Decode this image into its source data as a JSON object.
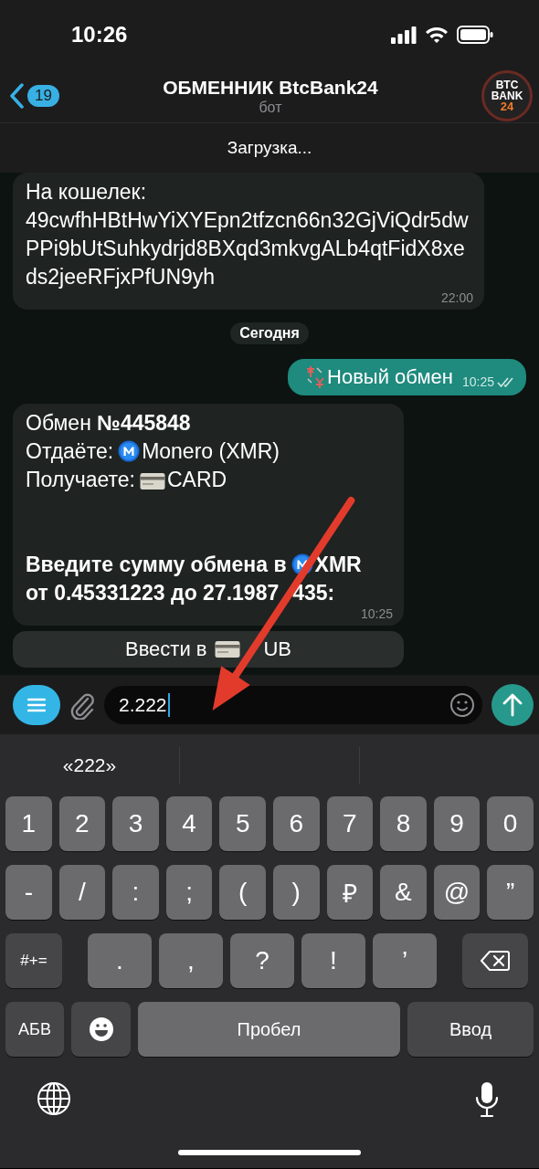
{
  "status_bar": {
    "time": "10:26"
  },
  "header": {
    "back_badge": "19",
    "title": "ОБМЕННИК BtcBank24",
    "subtitle": "бот",
    "avatar": [
      "BTC",
      "BANK",
      "24"
    ]
  },
  "banner": {
    "text": "Загрузка..."
  },
  "messages": [
    {
      "kind": "incoming",
      "time": "22:00",
      "lines": [
        {
          "bold": false,
          "parts": [
            {
              "kind": "text",
              "text": "На кошелек:"
            }
          ]
        },
        {
          "bold": false,
          "parts": [
            {
              "kind": "text",
              "text": "49cwfhHBtHwYiXYEpn2tfzcn66n32GjViQdr5dwPPi9bUtSuhkydrjd8BXqd3mkvgALb4qtFidX8xeds2jeeRFjxPfUN9yh"
            }
          ]
        }
      ]
    },
    {
      "kind": "date",
      "text": "Сегодня"
    },
    {
      "kind": "outgoing",
      "time": "10:25",
      "read": true,
      "lines": [
        {
          "bold": false,
          "parts": [
            {
              "kind": "exchange-emoji"
            },
            {
              "kind": "text",
              "text": "Новый обмен"
            }
          ]
        }
      ]
    },
    {
      "kind": "incoming",
      "time": "10:25",
      "lines": [
        {
          "bold": false,
          "parts": [
            {
              "kind": "text",
              "text": "Обмен **№445848**"
            }
          ]
        },
        {
          "bold": false,
          "parts": [
            {
              "kind": "text",
              "text": "Отдаёте:"
            },
            {
              "kind": "coin-emoji"
            },
            {
              "kind": "text",
              "text": "Monero (XMR)"
            }
          ]
        },
        {
          "bold": false,
          "parts": [
            {
              "kind": "text",
              "text": "Получаете:"
            },
            {
              "kind": "card-emoji"
            },
            {
              "kind": "text",
              "text": "CARD"
            }
          ]
        },
        {
          "bold": true,
          "parts": [
            {
              "kind": "text",
              "text": "Введите сумму обмена в"
            },
            {
              "kind": "coin-emoji"
            },
            {
              "kind": "text",
              "text": "XMR"
            }
          ]
        },
        {
          "bold": true,
          "parts": [
            {
              "kind": "text",
              "text": "от 0.45331223 до 27.1987"
            },
            {
              "kind": "covered"
            },
            {
              "kind": "text",
              "text": "435:"
            }
          ]
        }
      ]
    },
    {
      "kind": "inline_button",
      "parts": [
        {
          "kind": "text",
          "text": "Ввести в"
        },
        {
          "kind": "card-emoji"
        },
        {
          "kind": "covered"
        },
        {
          "kind": "text",
          "text": "UB"
        }
      ]
    }
  ],
  "composer": {
    "value": "2.222"
  },
  "keyboard": {
    "suggestions": [
      "«222»"
    ],
    "rows": [
      {
        "keys": [
          {
            "kind": "char",
            "label": "1"
          },
          {
            "kind": "char",
            "label": "2"
          },
          {
            "kind": "char",
            "label": "3"
          },
          {
            "kind": "char",
            "label": "4"
          },
          {
            "kind": "char",
            "label": "5"
          },
          {
            "kind": "char",
            "label": "6"
          },
          {
            "kind": "char",
            "label": "7"
          },
          {
            "kind": "char",
            "label": "8"
          },
          {
            "kind": "char",
            "label": "9"
          },
          {
            "kind": "char",
            "label": "0"
          }
        ]
      },
      {
        "keys": [
          {
            "kind": "char",
            "label": "-"
          },
          {
            "kind": "char",
            "label": "/"
          },
          {
            "kind": "char",
            "label": ":"
          },
          {
            "kind": "char",
            "label": ";"
          },
          {
            "kind": "char",
            "label": "("
          },
          {
            "kind": "char",
            "label": ")"
          },
          {
            "kind": "char",
            "label": "₽"
          },
          {
            "kind": "char",
            "label": "&"
          },
          {
            "kind": "char",
            "label": "@"
          },
          {
            "kind": "char",
            "label": "”"
          }
        ]
      },
      {
        "keys": [
          {
            "kind": "function",
            "label": "#+="
          },
          {
            "kind": "char",
            "label": "."
          },
          {
            "kind": "char",
            "label": ","
          },
          {
            "kind": "char",
            "label": "?"
          },
          {
            "kind": "char",
            "label": "!"
          },
          {
            "kind": "char",
            "label": "’"
          },
          {
            "kind": "backspace"
          }
        ]
      },
      {
        "keys": [
          {
            "kind": "function",
            "label": "АБВ"
          },
          {
            "kind": "emoji"
          },
          {
            "kind": "space",
            "label": "Пробел"
          },
          {
            "kind": "return",
            "label": "Ввод"
          }
        ]
      }
    ]
  }
}
